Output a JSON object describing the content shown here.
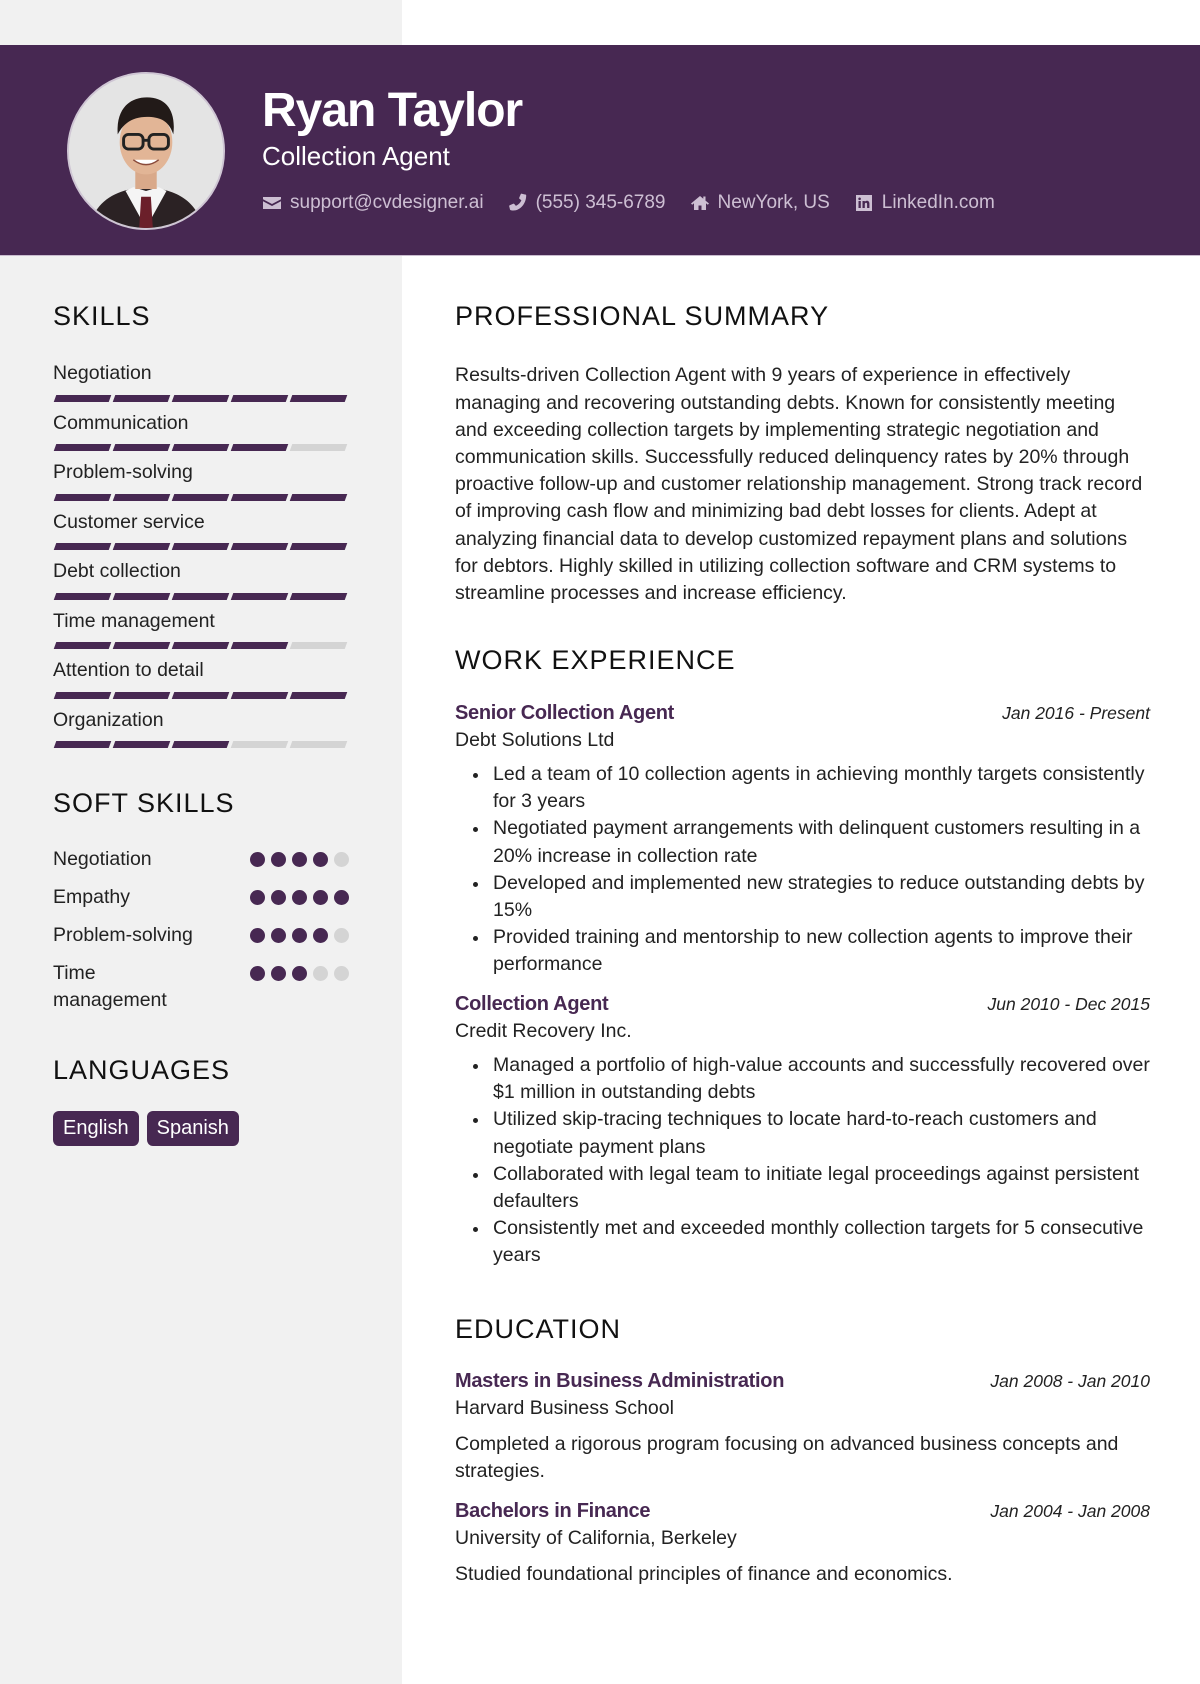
{
  "header": {
    "name": "Ryan Taylor",
    "title": "Collection Agent",
    "photo_alt": "profile-photo",
    "contacts": [
      {
        "icon": "envelope-icon",
        "text": "support@cvdesigner.ai"
      },
      {
        "icon": "phone-icon",
        "text": "(555) 345-6789"
      },
      {
        "icon": "home-icon",
        "text": "NewYork, US"
      },
      {
        "icon": "linkedin-icon",
        "text": "LinkedIn.com"
      }
    ]
  },
  "colors": {
    "accent": "#472852",
    "sidebar_bg": "#f1f1f1",
    "inactive": "#d4d4d4",
    "contact_text": "#cdbfd3"
  },
  "skills": {
    "title": "SKILLS",
    "max_level": 5,
    "items": [
      {
        "label": "Negotiation",
        "level": 5
      },
      {
        "label": "Communication",
        "level": 4
      },
      {
        "label": "Problem-solving",
        "level": 5
      },
      {
        "label": "Customer service",
        "level": 5
      },
      {
        "label": "Debt collection",
        "level": 5
      },
      {
        "label": "Time management",
        "level": 4
      },
      {
        "label": "Attention to detail",
        "level": 5
      },
      {
        "label": "Organization",
        "level": 3
      }
    ]
  },
  "soft_skills": {
    "title": "SOFT SKILLS",
    "max_level": 5,
    "items": [
      {
        "label": "Negotiation",
        "level": 4
      },
      {
        "label": "Empathy",
        "level": 5
      },
      {
        "label": "Problem-solving",
        "level": 4
      },
      {
        "label": "Time management",
        "level": 3
      }
    ]
  },
  "languages": {
    "title": "LANGUAGES",
    "items": [
      "English",
      "Spanish"
    ]
  },
  "summary": {
    "title": "PROFESSIONAL SUMMARY",
    "text": "Results-driven Collection Agent with 9 years of experience in effectively managing and recovering outstanding debts. Known for consistently meeting and exceeding collection targets by implementing strategic negotiation and communication skills. Successfully reduced delinquency rates by 20% through proactive follow-up and customer relationship management. Strong track record of improving cash flow and minimizing bad debt losses for clients. Adept at analyzing financial data to develop customized repayment plans and solutions for debtors. Highly skilled in utilizing collection software and CRM systems to streamline processes and increase efficiency."
  },
  "experience": {
    "title": "WORK EXPERIENCE",
    "jobs": [
      {
        "role": "Senior Collection Agent",
        "dates": "Jan 2016 - Present",
        "company": "Debt Solutions Ltd",
        "bullets": [
          "Led a team of 10 collection agents in achieving monthly targets consistently for 3 years",
          "Negotiated payment arrangements with delinquent customers resulting in a 20% increase in collection rate",
          "Developed and implemented new strategies to reduce outstanding debts by 15%",
          "Provided training and mentorship to new collection agents to improve their performance"
        ]
      },
      {
        "role": "Collection Agent",
        "dates": "Jun 2010 - Dec 2015",
        "company": "Credit Recovery Inc.",
        "bullets": [
          "Managed a portfolio of high-value accounts and successfully recovered over $1 million in outstanding debts",
          "Utilized skip-tracing techniques to locate hard-to-reach customers and negotiate payment plans",
          "Collaborated with legal team to initiate legal proceedings against persistent defaulters",
          "Consistently met and exceeded monthly collection targets for 5 consecutive years"
        ]
      }
    ]
  },
  "education": {
    "title": "EDUCATION",
    "items": [
      {
        "degree": "Masters in Business Administration",
        "dates": "Jan 2008 - Jan 2010",
        "school": "Harvard Business School",
        "description": "Completed a rigorous program focusing on advanced business concepts and strategies."
      },
      {
        "degree": "Bachelors in Finance",
        "dates": "Jan 2004 - Jan 2008",
        "school": "University of California, Berkeley",
        "description": "Studied foundational principles of finance and economics."
      }
    ]
  }
}
